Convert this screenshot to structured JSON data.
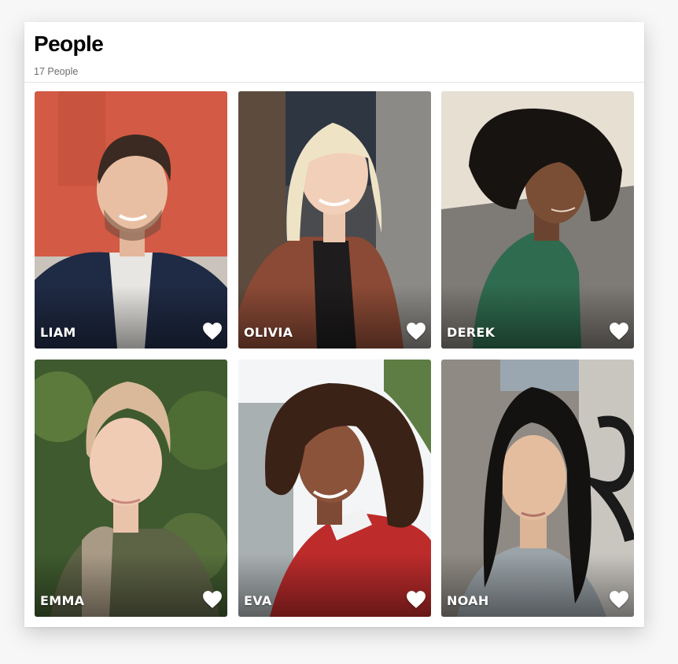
{
  "header": {
    "title": "People",
    "count_label": "17 People"
  },
  "people": [
    {
      "name": "LIAM",
      "favorite": true
    },
    {
      "name": "OLIVIA",
      "favorite": true
    },
    {
      "name": "DEREK",
      "favorite": true
    },
    {
      "name": "EMMA",
      "favorite": true
    },
    {
      "name": "EVA",
      "favorite": true
    },
    {
      "name": "NOAH",
      "favorite": true
    }
  ],
  "colors": {
    "heart": "#ffffff",
    "title": "#000000",
    "subtitle": "#6e6e73"
  }
}
